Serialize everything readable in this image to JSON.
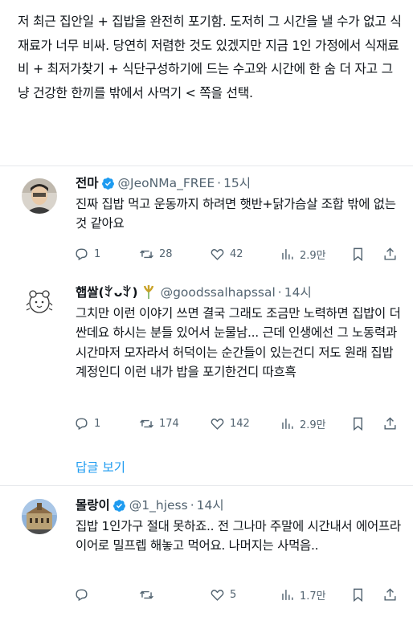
{
  "main_post": {
    "text": "저 최근 집안일 + 집밥을 완전히 포기함. 도저히 그 시간을 낼 수가 없고 식재료가 너무 비싸. 당연히 저렴한 것도 있겠지만 지금 1인 가정에서 식재료비 + 최저가찾기 + 식단구성하기에 드는 수고와 시간에 한 숨 더 자고 그냥 건강한 한끼를 밖에서 사먹기 < 쪽을 선택."
  },
  "replies": [
    {
      "name": "전마",
      "handle": "@JeoNMa_FREE",
      "time": "15시",
      "text": "진짜 집밥 먹고 운동까지 하려면 햇반+닭가슴살 조합 밖에 없는 것 같아요",
      "stats": {
        "replies": "1",
        "retweets": "28",
        "likes": "42",
        "views": "2.9만"
      }
    },
    {
      "name": "햅쌀(",
      "name_emote": "ꇬᴗꇬ)",
      "handle": "@goodssalhapssal",
      "time": "14시",
      "text": "그치만 이런 이야기 쓰면 결국 그래도 조금만 노력하면 집밥이 더 싼데요 하시는 분들 있어서 눈물남... 근데 인생에선 그 노동력과 시간마저 모자라서 허덕이는 순간들이 있는건디 저도 원래 집밥계정인디 이런 내가 밥을 포기한건디 따흐흑",
      "stats": {
        "replies": "1",
        "retweets": "174",
        "likes": "142",
        "views": "2.9만"
      }
    },
    {
      "name": "몰랑이",
      "handle": "@1_hjess",
      "time": "14시",
      "text": "집밥 1인가구 절대 못하죠.. 전 그나마 주말에 시간내서 에어프라이어로 밀프렙 해놓고 먹어요. 나머지는 사먹음..",
      "stats": {
        "replies": "",
        "retweets": "",
        "likes": "5",
        "views": "1.7만"
      }
    }
  ],
  "show_replies_label": "답글 보기",
  "colors": {
    "accent": "#1d9bf0",
    "secondary_text": "#536471",
    "divider": "#e6e9ec"
  }
}
